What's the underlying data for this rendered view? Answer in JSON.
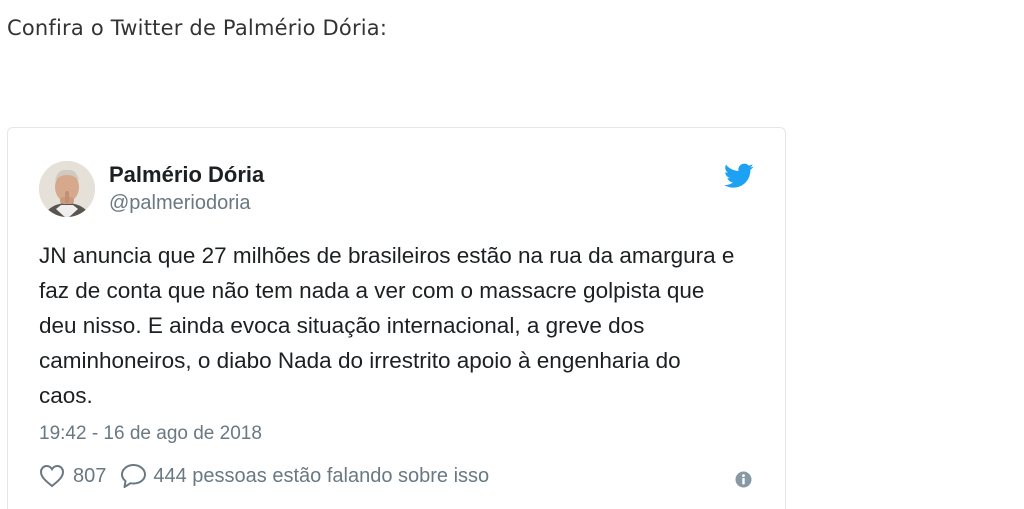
{
  "intro": {
    "text": "Confira o Twitter de Palmério Dória:"
  },
  "tweet": {
    "author": {
      "name": "Palmério Dória",
      "handle": "@palmeriodoria"
    },
    "icons": {
      "brand": "twitter-bird-icon",
      "like": "heart-icon",
      "reply": "speech-bubble-icon",
      "info": "info-icon"
    },
    "accent_color": "#1da1f2",
    "text": "JN anuncia que 27 milhões de brasileiros estão na rua da amargura e faz de conta que não tem nada a ver com o massacre golpista que deu nisso. E ainda evoca situação internacional, a greve dos caminhoneiros, o diabo Nada do irrestrito apoio à engenharia do caos.",
    "timestamp": "19:42 - 16 de ago de 2018",
    "likes": "807",
    "replies_text": "444 pessoas estão falando sobre isso"
  }
}
